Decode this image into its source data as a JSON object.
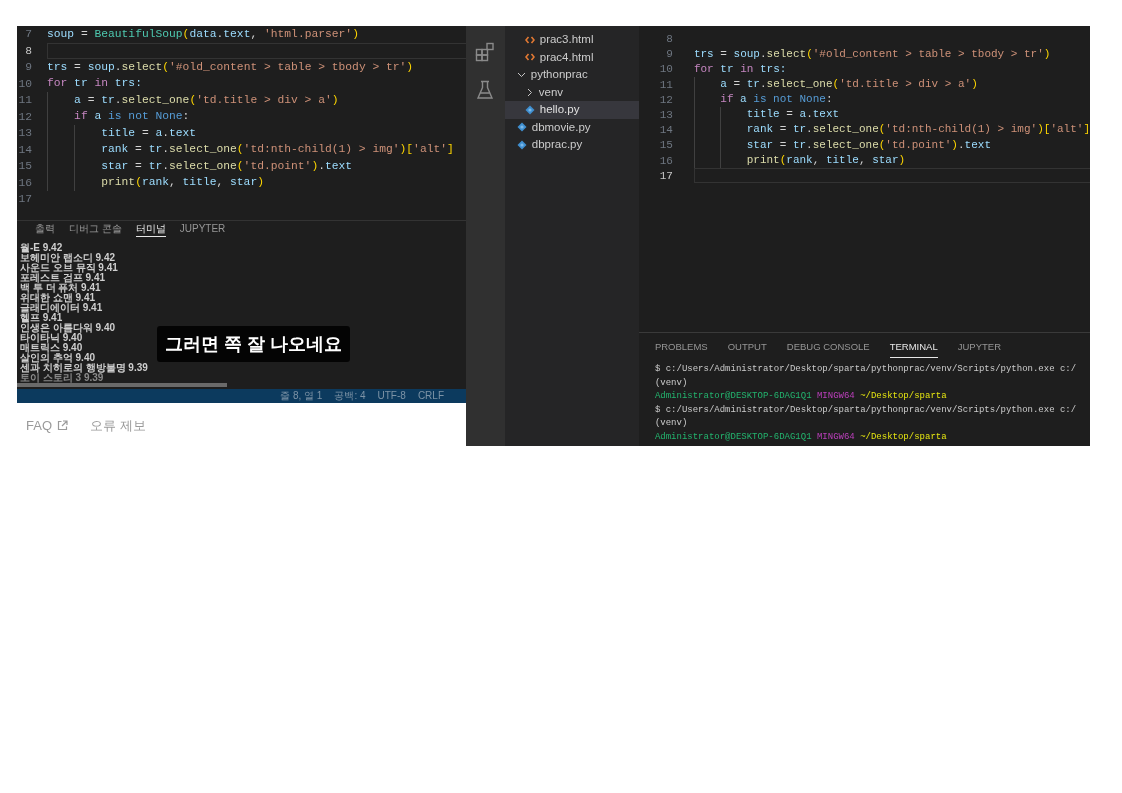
{
  "video": {
    "editor": {
      "lines": [
        {
          "number": "7",
          "current": false,
          "tokens": [
            {
              "text": "soup",
              "kind": "var"
            },
            {
              "text": " = ",
              "kind": "plain"
            },
            {
              "text": "BeautifulSoup",
              "kind": "class"
            },
            {
              "text": "(",
              "kind": "brace"
            },
            {
              "text": "data",
              "kind": "var"
            },
            {
              "text": ".",
              "kind": "plain"
            },
            {
              "text": "text",
              "kind": "var"
            },
            {
              "text": ", ",
              "kind": "plain"
            },
            {
              "text": "'html.parser'",
              "kind": "str"
            },
            {
              "text": ")",
              "kind": "brace"
            }
          ]
        },
        {
          "number": "8",
          "current": true
        },
        {
          "number": "9",
          "current": false,
          "tokens": [
            {
              "text": "trs",
              "kind": "var"
            },
            {
              "text": " = ",
              "kind": "plain"
            },
            {
              "text": "soup",
              "kind": "var"
            },
            {
              "text": ".",
              "kind": "plain"
            },
            {
              "text": "select",
              "kind": "func"
            },
            {
              "text": "(",
              "kind": "brace"
            },
            {
              "text": "'#old_content > table > tbody > tr'",
              "kind": "str"
            },
            {
              "text": ")",
              "kind": "brace"
            }
          ]
        },
        {
          "number": "10",
          "current": false,
          "tokens": [
            {
              "text": "for",
              "kind": "ctrl"
            },
            {
              "text": " tr ",
              "kind": "var"
            },
            {
              "text": "in",
              "kind": "ctrl"
            },
            {
              "text": " trs:",
              "kind": "var"
            }
          ],
          "children": [
            {
              "number": "11",
              "current": false,
              "tokens": [
                {
                  "text": "a",
                  "kind": "var"
                },
                {
                  "text": " = ",
                  "kind": "plain"
                },
                {
                  "text": "tr",
                  "kind": "var"
                },
                {
                  "text": ".",
                  "kind": "plain"
                },
                {
                  "text": "select_one",
                  "kind": "func"
                },
                {
                  "text": "(",
                  "kind": "brace"
                },
                {
                  "text": "'td.title > div > a'",
                  "kind": "str"
                },
                {
                  "text": ")",
                  "kind": "brace"
                }
              ]
            },
            {
              "number": "12",
              "current": false,
              "tokens": [
                {
                  "text": "if",
                  "kind": "ctrl"
                },
                {
                  "text": " a ",
                  "kind": "var"
                },
                {
                  "text": "is not None",
                  "kind": "kw"
                },
                {
                  "text": ":",
                  "kind": "plain"
                }
              ],
              "children": [
                {
                  "number": "13",
                  "current": false,
                  "tokens": [
                    {
                      "text": "title",
                      "kind": "var"
                    },
                    {
                      "text": " = ",
                      "kind": "plain"
                    },
                    {
                      "text": "a",
                      "kind": "var"
                    },
                    {
                      "text": ".",
                      "kind": "plain"
                    },
                    {
                      "text": "text",
                      "kind": "var"
                    }
                  ]
                },
                {
                  "number": "14",
                  "current": false,
                  "tokens": [
                    {
                      "text": "rank",
                      "kind": "var"
                    },
                    {
                      "text": " = ",
                      "kind": "plain"
                    },
                    {
                      "text": "tr",
                      "kind": "var"
                    },
                    {
                      "text": ".",
                      "kind": "plain"
                    },
                    {
                      "text": "select_one",
                      "kind": "func"
                    },
                    {
                      "text": "(",
                      "kind": "brace"
                    },
                    {
                      "text": "'td:nth-child(1) > img'",
                      "kind": "str"
                    },
                    {
                      "text": ")[",
                      "kind": "brace"
                    },
                    {
                      "text": "'alt'",
                      "kind": "str"
                    },
                    {
                      "text": "]",
                      "kind": "brace"
                    }
                  ]
                },
                {
                  "number": "15",
                  "current": false,
                  "tokens": [
                    {
                      "text": "star",
                      "kind": "var"
                    },
                    {
                      "text": " = ",
                      "kind": "plain"
                    },
                    {
                      "text": "tr",
                      "kind": "var"
                    },
                    {
                      "text": ".",
                      "kind": "plain"
                    },
                    {
                      "text": "select_one",
                      "kind": "func"
                    },
                    {
                      "text": "(",
                      "kind": "brace"
                    },
                    {
                      "text": "'td.point'",
                      "kind": "str"
                    },
                    {
                      "text": ")",
                      "kind": "brace"
                    },
                    {
                      "text": ".",
                      "kind": "plain"
                    },
                    {
                      "text": "text",
                      "kind": "var"
                    }
                  ]
                },
                {
                  "number": "16",
                  "current": false,
                  "tokens": [
                    {
                      "text": "print",
                      "kind": "func"
                    },
                    {
                      "text": "(",
                      "kind": "brace"
                    },
                    {
                      "text": "rank",
                      "kind": "var"
                    },
                    {
                      "text": ", ",
                      "kind": "plain"
                    },
                    {
                      "text": "title",
                      "kind": "var"
                    },
                    {
                      "text": ", ",
                      "kind": "plain"
                    },
                    {
                      "text": "star",
                      "kind": "var"
                    },
                    {
                      "text": ")",
                      "kind": "brace"
                    }
                  ]
                }
              ]
            }
          ]
        },
        {
          "number": "17",
          "current": false
        }
      ]
    },
    "panel": {
      "tabs": [
        {
          "label": "출력",
          "selected": false
        },
        {
          "label": "디버그 콘솔",
          "selected": false
        },
        {
          "label": "터미널",
          "selected": true
        },
        {
          "label": "JUPYTER",
          "selected": false
        }
      ],
      "output": [
        "월-E 9.42",
        "보헤미안 랩소디 9.42",
        "사운드 오브 뮤직 9.41",
        "포레스트 검프 9.41",
        "백 투 더 퓨처 9.41",
        "위대한 쇼맨 9.41",
        "글래디에이터 9.41",
        "헬프 9.41",
        "인생은 아름다워 9.40",
        "타이타닉 9.40",
        "매트릭스 9.40",
        "살인의 추억 9.40",
        "센과 치히로의 행방불명 9.39",
        "토이 스토리 3 9.39"
      ]
    },
    "status_bar": [
      "줄 8, 열 1",
      "공백: 4",
      "UTF-8",
      "CRLF"
    ],
    "subtitle": "그러면 쪽 잘 나오네요"
  },
  "links": [
    {
      "label": "FAQ",
      "external": true
    },
    {
      "label": "오류 제보",
      "external": false
    }
  ],
  "vscode": {
    "explorer": {
      "items": [
        {
          "children": [
            {
              "label": "prac3.html",
              "kind": "html",
              "selected": false
            },
            {
              "label": "prac4.html",
              "kind": "html",
              "selected": false
            }
          ]
        },
        {
          "label": "pythonprac",
          "kind": "folder",
          "expanded": true,
          "selected": false,
          "children": [
            {
              "label": "venv",
              "kind": "folder",
              "expanded": false,
              "selected": false
            },
            {
              "label": "hello.py",
              "kind": "python",
              "selected": true
            }
          ]
        },
        {
          "label": "dbmovie.py",
          "kind": "python",
          "selected": false
        },
        {
          "label": "dbprac.py",
          "kind": "python",
          "selected": false
        }
      ]
    },
    "editor": {
      "lines": [
        {
          "number": "8",
          "current": false
        },
        {
          "number": "9",
          "current": false,
          "tokens": [
            {
              "text": "trs",
              "kind": "var"
            },
            {
              "text": " = ",
              "kind": "plain"
            },
            {
              "text": "soup",
              "kind": "var"
            },
            {
              "text": ".",
              "kind": "plain"
            },
            {
              "text": "select",
              "kind": "func"
            },
            {
              "text": "(",
              "kind": "brace"
            },
            {
              "text": "'#old_content > table > tbody > tr'",
              "kind": "str"
            },
            {
              "text": ")",
              "kind": "brace"
            }
          ]
        },
        {
          "number": "10",
          "current": false,
          "tokens": [
            {
              "text": "for",
              "kind": "ctrl"
            },
            {
              "text": " tr ",
              "kind": "var"
            },
            {
              "text": "in",
              "kind": "ctrl"
            },
            {
              "text": " trs:",
              "kind": "var"
            }
          ],
          "children": [
            {
              "number": "11",
              "current": false,
              "tokens": [
                {
                  "text": "a",
                  "kind": "var"
                },
                {
                  "text": " = ",
                  "kind": "plain"
                },
                {
                  "text": "tr",
                  "kind": "var"
                },
                {
                  "text": ".",
                  "kind": "plain"
                },
                {
                  "text": "select_one",
                  "kind": "func"
                },
                {
                  "text": "(",
                  "kind": "brace"
                },
                {
                  "text": "'td.title > div > a'",
                  "kind": "str"
                },
                {
                  "text": ")",
                  "kind": "brace"
                }
              ]
            },
            {
              "number": "12",
              "current": false,
              "tokens": [
                {
                  "text": "if",
                  "kind": "ctrl"
                },
                {
                  "text": " a ",
                  "kind": "var"
                },
                {
                  "text": "is not None",
                  "kind": "kw"
                },
                {
                  "text": ":",
                  "kind": "plain"
                }
              ],
              "children": [
                {
                  "number": "13",
                  "current": false,
                  "tokens": [
                    {
                      "text": "title",
                      "kind": "var"
                    },
                    {
                      "text": " = ",
                      "kind": "plain"
                    },
                    {
                      "text": "a",
                      "kind": "var"
                    },
                    {
                      "text": ".",
                      "kind": "plain"
                    },
                    {
                      "text": "text",
                      "kind": "var"
                    }
                  ]
                },
                {
                  "number": "14",
                  "current": false,
                  "tokens": [
                    {
                      "text": "rank",
                      "kind": "var"
                    },
                    {
                      "text": " = ",
                      "kind": "plain"
                    },
                    {
                      "text": "tr",
                      "kind": "var"
                    },
                    {
                      "text": ".",
                      "kind": "plain"
                    },
                    {
                      "text": "select_one",
                      "kind": "func"
                    },
                    {
                      "text": "(",
                      "kind": "brace"
                    },
                    {
                      "text": "'td:nth-child(1) > img'",
                      "kind": "str"
                    },
                    {
                      "text": ")[",
                      "kind": "brace"
                    },
                    {
                      "text": "'alt'",
                      "kind": "str"
                    },
                    {
                      "text": "]",
                      "kind": "brace"
                    }
                  ]
                },
                {
                  "number": "15",
                  "current": false,
                  "tokens": [
                    {
                      "text": "star",
                      "kind": "var"
                    },
                    {
                      "text": " = ",
                      "kind": "plain"
                    },
                    {
                      "text": "tr",
                      "kind": "var"
                    },
                    {
                      "text": ".",
                      "kind": "plain"
                    },
                    {
                      "text": "select_one",
                      "kind": "func"
                    },
                    {
                      "text": "(",
                      "kind": "brace"
                    },
                    {
                      "text": "'td.point'",
                      "kind": "str"
                    },
                    {
                      "text": ")",
                      "kind": "brace"
                    },
                    {
                      "text": ".",
                      "kind": "plain"
                    },
                    {
                      "text": "text",
                      "kind": "var"
                    }
                  ]
                },
                {
                  "number": "16",
                  "current": false,
                  "tokens": [
                    {
                      "text": "print",
                      "kind": "func"
                    },
                    {
                      "text": "(",
                      "kind": "brace"
                    },
                    {
                      "text": "rank",
                      "kind": "var"
                    },
                    {
                      "text": ", ",
                      "kind": "plain"
                    },
                    {
                      "text": "title",
                      "kind": "var"
                    },
                    {
                      "text": ", ",
                      "kind": "plain"
                    },
                    {
                      "text": "star",
                      "kind": "var"
                    },
                    {
                      "text": ")",
                      "kind": "brace"
                    }
                  ]
                }
              ]
            }
          ]
        },
        {
          "number": "17",
          "current": true
        }
      ]
    },
    "panel": {
      "tabs": [
        {
          "label": "PROBLEMS",
          "selected": false
        },
        {
          "label": "OUTPUT",
          "selected": false
        },
        {
          "label": "DEBUG CONSOLE",
          "selected": false
        },
        {
          "label": "TERMINAL",
          "selected": true
        },
        {
          "label": "JUPYTER",
          "selected": false
        }
      ],
      "terminal": [
        [
          {
            "text": "$ c:/Users/Administrator/Desktop/sparta/pythonprac/venv/Scripts/python.exe c:/",
            "kind": "plain"
          }
        ],
        [
          {
            "text": "(venv)",
            "kind": "plain"
          }
        ],
        [
          {
            "text": "Administrator@DESKTOP-6DAG1Q1",
            "kind": "user"
          },
          {
            "text": " MINGW64",
            "kind": "host"
          },
          {
            "text": " ~/Desktop/sparta",
            "kind": "path"
          }
        ],
        [
          {
            "text": "$ c:/Users/Administrator/Desktop/sparta/pythonprac/venv/Scripts/python.exe c:/",
            "kind": "plain"
          }
        ],
        [
          {
            "text": "(venv)",
            "kind": "plain"
          }
        ],
        [
          {
            "text": "Administrator@DESKTOP-6DAG1Q1",
            "kind": "user"
          },
          {
            "text": " MINGW64",
            "kind": "host"
          },
          {
            "text": " ~/Desktop/sparta",
            "kind": "path"
          }
        ]
      ]
    }
  }
}
